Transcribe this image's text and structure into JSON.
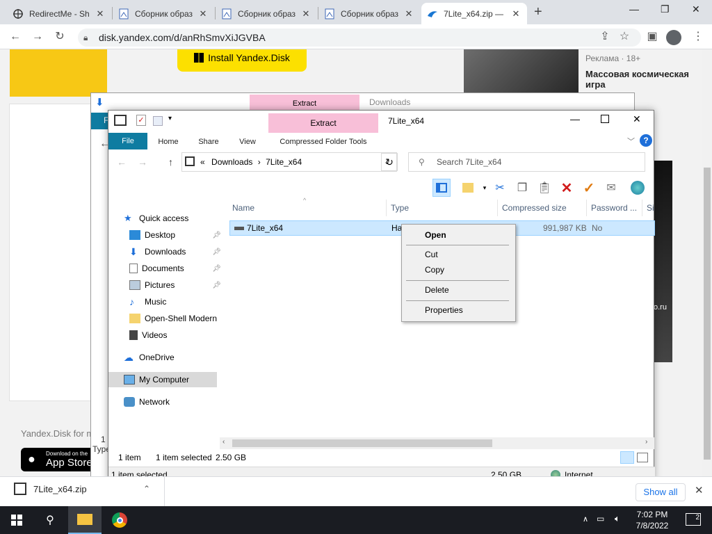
{
  "browser": {
    "tabs": [
      {
        "label": "RedirectMe - Sh"
      },
      {
        "label": "Сборник образ"
      },
      {
        "label": "Сборник образ"
      },
      {
        "label": "Сборник образ"
      },
      {
        "label": "7Lite_x64.zip —"
      }
    ],
    "url": "disk.yandex.com/d/anRhSmvXiJGVBA"
  },
  "yandex": {
    "install_label": "Install Yandex.Disk",
    "ad_label": "Реклама · 18+",
    "ad_title": "Массовая космическая игра",
    "ydisk_text": "Yandex.Disk for m",
    "appstore_small": "Download on the",
    "appstore_big": "App Store",
    "ad_domain": "o.ru"
  },
  "explorer_back": {
    "title": "Downloads",
    "extract_tab": "Extract",
    "file_tab": "F"
  },
  "explorer": {
    "title": "7Lite_x64",
    "extract_tab": "Extract",
    "menu": {
      "file": "File",
      "home": "Home",
      "share": "Share",
      "view": "View",
      "compressed": "Compressed Folder Tools"
    },
    "path": {
      "prefix": "«",
      "seg1": "Downloads",
      "sep": "›",
      "seg2": "7Lite_x64"
    },
    "search_placeholder": "Search 7Lite_x64",
    "tree": [
      {
        "label": "Quick access"
      },
      {
        "label": "Desktop"
      },
      {
        "label": "Downloads"
      },
      {
        "label": "Documents"
      },
      {
        "label": "Pictures"
      },
      {
        "label": "Music"
      },
      {
        "label": "Open-Shell Modern"
      },
      {
        "label": "Videos"
      },
      {
        "label": "OneDrive"
      },
      {
        "label": "My Computer"
      },
      {
        "label": "Network"
      }
    ],
    "columns": {
      "name": "Name",
      "type": "Type",
      "csize": "Compressed size",
      "password": "Password ...",
      "size": "Si"
    },
    "row": {
      "name": "7Lite_x64",
      "type": "Ha",
      "csize": "991,987 KB",
      "password": "No"
    },
    "status": {
      "items": "1 item",
      "selected": "1 item selected",
      "size": "2.50 GB"
    },
    "status2": {
      "selected": "1 item selected",
      "size": "2.50 GB",
      "zone": "Internet"
    },
    "hidden_type": "Type",
    "hidden_count": "1 i"
  },
  "context_menu": {
    "open": "Open",
    "cut": "Cut",
    "copy": "Copy",
    "delete": "Delete",
    "properties": "Properties"
  },
  "download_bar": {
    "file": "7Lite_x64.zip",
    "show_all": "Show all"
  },
  "taskbar": {
    "time": "7:02 PM",
    "date": "7/8/2022",
    "notif_count": "2"
  },
  "colors": {
    "accent": "#0f7ca1",
    "extract_tab": "#f8bfd8",
    "selection": "#cce8ff",
    "delete_red": "#d11b1b",
    "check_orange": "#e07b12"
  }
}
